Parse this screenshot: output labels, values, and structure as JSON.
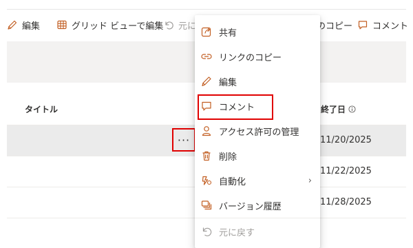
{
  "colors": {
    "accent": "#c25e22",
    "highlight": "#e00000",
    "disabled": "#a19f9d"
  },
  "toolbar": {
    "edit": {
      "label": "編集",
      "icon": "pencil-icon"
    },
    "grid_edit": {
      "label": "グリッド ビューで編集",
      "icon": "grid-icon"
    },
    "undo": {
      "label": "元に",
      "icon": "undo-icon"
    },
    "copy_link": {
      "label": "のコピー"
    },
    "comment": {
      "label": "コメント",
      "icon": "comment-icon"
    }
  },
  "list": {
    "columns": {
      "title": "タイトル",
      "end_date": "終了日"
    },
    "rows": [
      {
        "end_date": "11/20/2025"
      },
      {
        "end_date": "11/22/2025"
      },
      {
        "end_date": "11/28/2025"
      }
    ],
    "more_label": "···"
  },
  "context_menu": {
    "items": [
      {
        "label": "共有",
        "icon": "share-icon"
      },
      {
        "label": "リンクのコピー",
        "icon": "link-icon"
      },
      {
        "label": "編集",
        "icon": "pencil-icon"
      },
      {
        "label": "コメント",
        "icon": "comment-icon"
      },
      {
        "label": "アクセス許可の管理",
        "icon": "person-icon"
      },
      {
        "label": "削除",
        "icon": "trash-icon"
      },
      {
        "label": "自動化",
        "icon": "automate-icon",
        "submenu": "›"
      },
      {
        "label": "バージョン履歴",
        "icon": "version-history-icon"
      },
      {
        "label": "元に戻す",
        "icon": "undo-icon"
      }
    ]
  }
}
